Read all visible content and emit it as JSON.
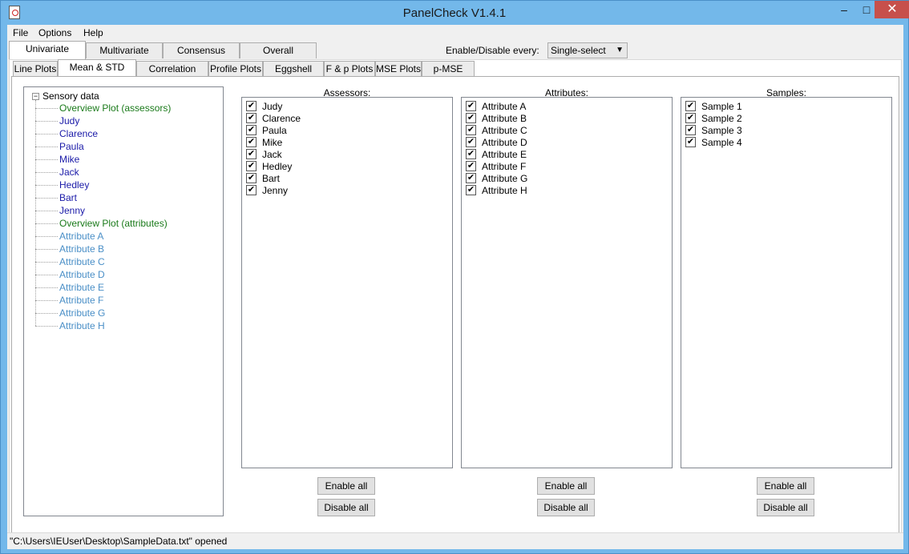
{
  "window": {
    "title": "PanelCheck V1.4.1"
  },
  "menu": [
    "File",
    "Options",
    "Help"
  ],
  "top_tabs": [
    "Univariate",
    "Multivariate",
    "Consensus",
    "Overall"
  ],
  "enable_label": "Enable/Disable every:",
  "select_value": "Single-select",
  "sub_tabs": [
    "Line Plots",
    "Mean & STD Plots",
    "Correlation Plots",
    "Profile Plots",
    "Eggshell Plots",
    "F & p Plots",
    "MSE Plots",
    "p-MSE Plots"
  ],
  "tree": {
    "root": "Sensory data",
    "items": [
      "Overview Plot (assessors)",
      "Judy",
      "Clarence",
      "Paula",
      "Mike",
      "Jack",
      "Hedley",
      "Bart",
      "Jenny",
      "Overview Plot (attributes)",
      "Attribute A",
      "Attribute B",
      "Attribute C",
      "Attribute D",
      "Attribute E",
      "Attribute F",
      "Attribute G",
      "Attribute H"
    ]
  },
  "assessors": {
    "title": "Assessors:",
    "items": [
      "Judy",
      "Clarence",
      "Paula",
      "Mike",
      "Jack",
      "Hedley",
      "Bart",
      "Jenny"
    ]
  },
  "attributes": {
    "title": "Attributes:",
    "items": [
      "Attribute A",
      "Attribute B",
      "Attribute C",
      "Attribute D",
      "Attribute E",
      "Attribute F",
      "Attribute G",
      "Attribute H"
    ]
  },
  "samples": {
    "title": "Samples:",
    "items": [
      "Sample 1",
      "Sample 2",
      "Sample 3",
      "Sample 4"
    ]
  },
  "buttons": {
    "enable_all": "Enable all",
    "disable_all": "Disable all"
  },
  "status": "\"C:\\Users\\IEUser\\Desktop\\SampleData.txt\" opened",
  "colors": {
    "overview": "#1a7a1a",
    "assessor": "#1a1aa8",
    "attribute": "#4a8fc7"
  }
}
